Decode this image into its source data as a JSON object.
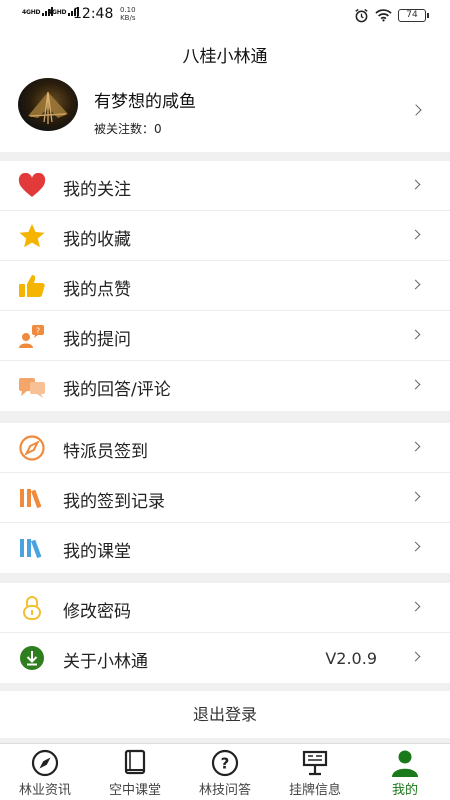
{
  "status_bar": {
    "signal1": "4GHD",
    "signal2": "4GHD",
    "time": "12:48",
    "speed_value": "0.10",
    "speed_unit": "KB/s",
    "battery": "74",
    "icons": [
      "alarm-icon",
      "wifi-icon",
      "battery-icon"
    ]
  },
  "header": {
    "title": "八桂小林通"
  },
  "profile": {
    "username": "有梦想的咸鱼",
    "followers": "被关注数：0"
  },
  "menu_group_1": [
    {
      "label": "我的关注",
      "icon": "heart-icon",
      "color": "#e23a3a"
    },
    {
      "label": "我的收藏",
      "icon": "star-icon",
      "color": "#f5b400"
    },
    {
      "label": "我的点赞",
      "icon": "thumbs-up-icon",
      "color": "#f5b400"
    },
    {
      "label": "我的提问",
      "icon": "question-user-icon",
      "color": "#f08a3c"
    },
    {
      "label": "我的回答/评论",
      "icon": "chat-bubbles-icon",
      "color": "#f5a56a"
    }
  ],
  "menu_group_2": [
    {
      "label": "特派员签到",
      "icon": "compass-icon",
      "color": "#f08a3c"
    },
    {
      "label": "我的签到记录",
      "icon": "books-icon",
      "color": "#f08a3c"
    },
    {
      "label": "我的课堂",
      "icon": "books-blue-icon",
      "color": "#4aa3df"
    }
  ],
  "menu_group_3": [
    {
      "label": "修改密码",
      "icon": "lock-icon",
      "color": "#f0c030"
    },
    {
      "label": "关于小林通",
      "icon": "download-circle-icon",
      "color": "#2e7d1f",
      "version": "V2.0.9"
    }
  ],
  "logout_label": "退出登录",
  "tabs": [
    {
      "label": "林业资讯",
      "icon": "compass-icon"
    },
    {
      "label": "空中课堂",
      "icon": "book-icon"
    },
    {
      "label": "林技问答",
      "icon": "question-circle-icon"
    },
    {
      "label": "挂牌信息",
      "icon": "signboard-icon"
    },
    {
      "label": "我的",
      "icon": "user-icon",
      "active": true
    }
  ],
  "colors": {
    "accent": "#1a7a1a",
    "background": "#f0f0f0"
  }
}
